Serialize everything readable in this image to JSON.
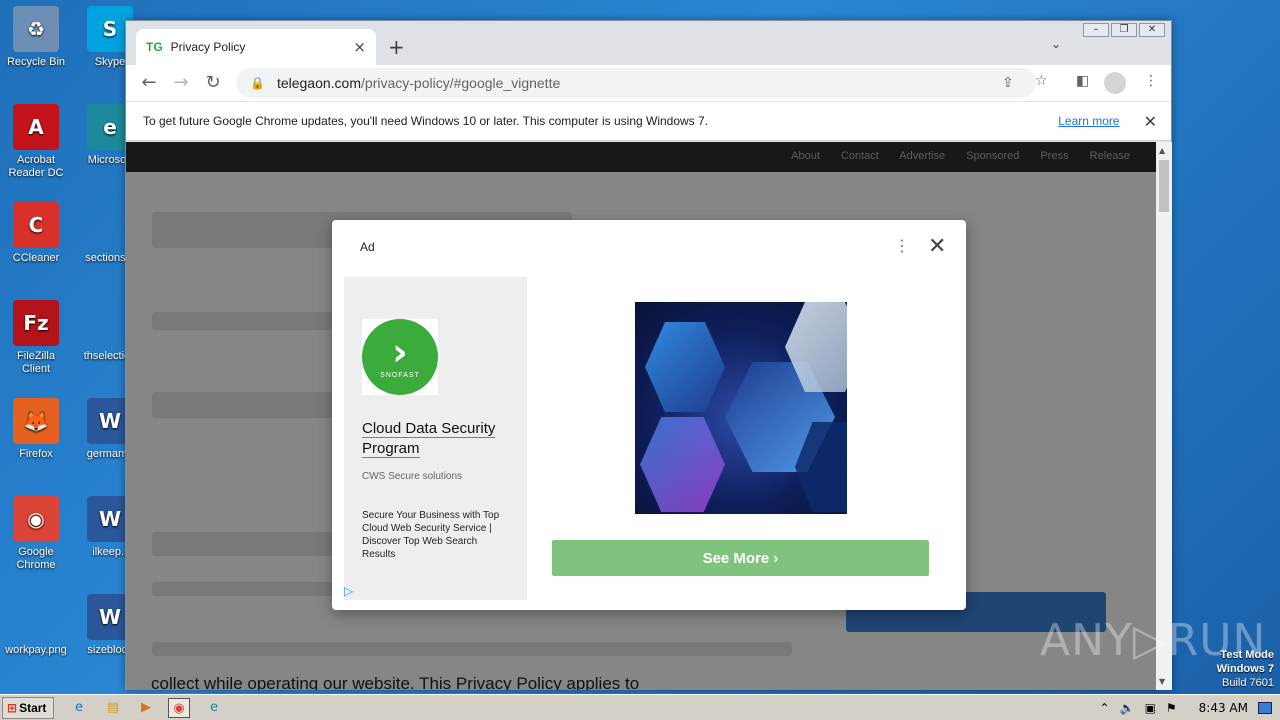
{
  "desktop": {
    "icons": [
      {
        "label": "Recycle Bin",
        "glyph": "♻",
        "color": "#6d8fb3"
      },
      {
        "label": "Skype",
        "glyph": "S",
        "color": "#00a3e0"
      },
      {
        "label": "Acrobat Reader DC",
        "glyph": "A",
        "color": "#c4141b"
      },
      {
        "label": "Microsoft",
        "glyph": "e",
        "color": "#1d8a9b"
      },
      {
        "label": "CCleaner",
        "glyph": "C",
        "color": "#d8312b"
      },
      {
        "label": "sectionsm",
        "glyph": "",
        "color": "#000000"
      },
      {
        "label": "FileZilla Client",
        "glyph": "Fz",
        "color": "#b3141c"
      },
      {
        "label": "thselection",
        "glyph": "",
        "color": "#1f6fb9"
      },
      {
        "label": "Firefox",
        "glyph": "🦊",
        "color": "#e66022"
      },
      {
        "label": "germanyr",
        "glyph": "W",
        "color": "#2b579a"
      },
      {
        "label": "Google Chrome",
        "glyph": "◉",
        "color": "#db4437"
      },
      {
        "label": "ilkeep.r",
        "glyph": "W",
        "color": "#2b579a"
      },
      {
        "label": "workpay.png",
        "glyph": "",
        "color": "#1f6fb9"
      },
      {
        "label": "sizeblock",
        "glyph": "W",
        "color": "#2b579a"
      }
    ]
  },
  "browser": {
    "tab": {
      "favicon": "TG",
      "title": "Privacy Policy",
      "close": "×"
    },
    "new_tab": "+",
    "url_host": "telegaon.com",
    "url_path": "/privacy-policy/#google_vignette",
    "infobar": {
      "text": "To get future Google Chrome updates, you'll need Windows 10 or later. This computer is using Windows 7.",
      "link": "Learn more",
      "close": "✕"
    }
  },
  "page": {
    "nav_links": "About Contact Advertise Sponsored Press Release",
    "bottom_text": "collect while operating our website. This Privacy Policy applies to"
  },
  "ad": {
    "label": "Ad",
    "brand": "SNOFAST",
    "title": "Cloud Data Security Program",
    "subtitle": "CWS Secure solutions",
    "description": "Secure Your Business with Top Cloud Web Security Service | Discover Top Web Search Results",
    "cta": "See More ›"
  },
  "watermark": "ANY▷RUN",
  "os": {
    "test_mode_line1": "Test Mode",
    "test_mode_line2": "Windows 7",
    "build": "Build 7601",
    "start": "Start",
    "clock": "8:43 AM"
  }
}
